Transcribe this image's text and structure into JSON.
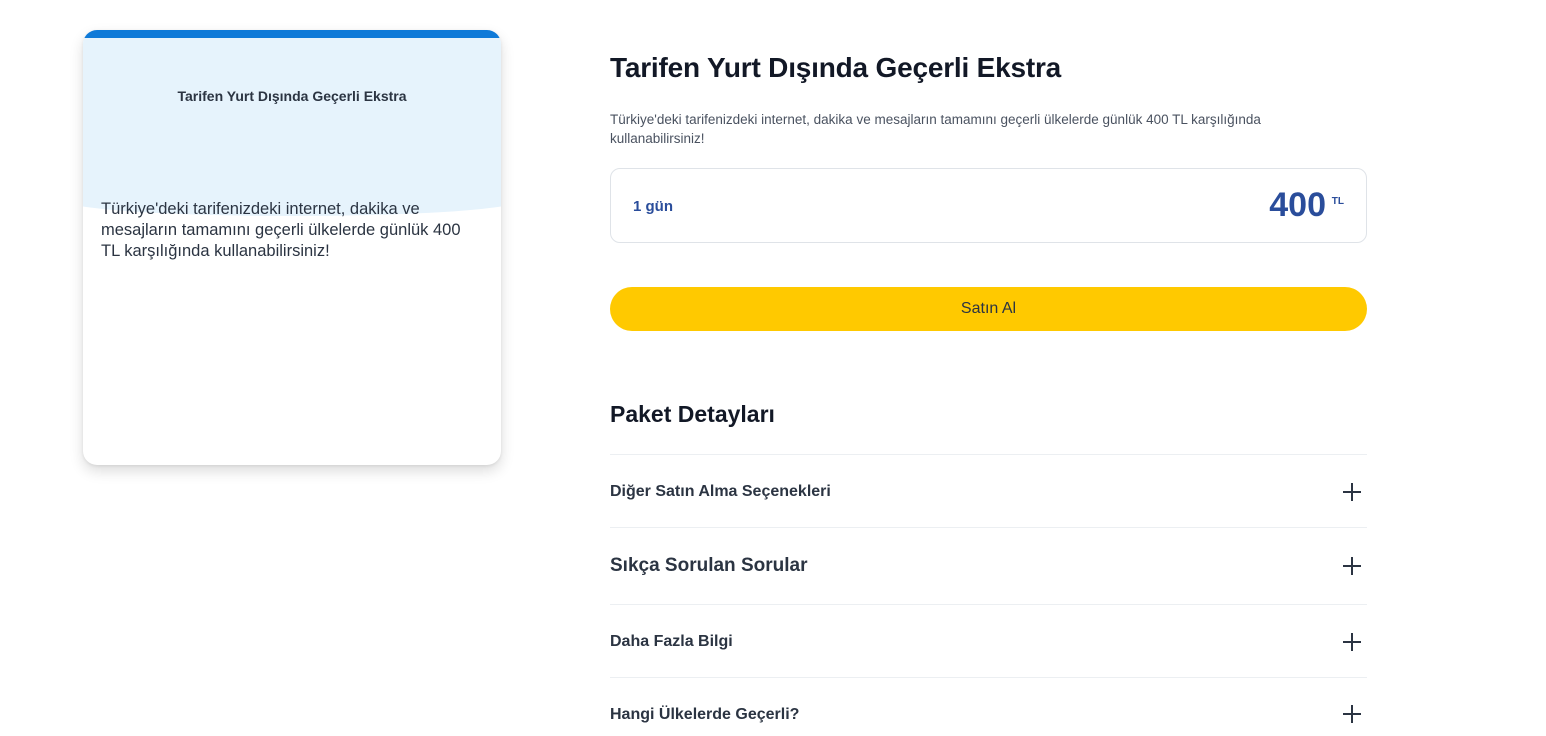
{
  "card": {
    "header_title": "Tarifen Yurt Dışında Geçerli Ekstra",
    "description": "Türkiye'deki tarifenizdeki internet, dakika ve mesajların tamamını geçerli ülkelerde günlük 400 TL karşılığında kullanabilirsiniz!"
  },
  "main": {
    "title": "Tarifen Yurt Dışında Geçerli Ekstra",
    "description": "Türkiye'deki tarifenizdeki internet, dakika ve mesajların tamamını geçerli ülkelerde günlük 400 TL karşılığında kullanabilirsiniz!",
    "option": {
      "duration": "1 gün",
      "price": "400",
      "currency": "TL"
    },
    "buy_label": "Satın Al"
  },
  "details": {
    "title": "Paket Detayları",
    "items": [
      {
        "label": "Diğer Satın Alma Seçenekleri"
      },
      {
        "label": "Sıkça Sorulan Sorular"
      },
      {
        "label": "Daha Fazla Bilgi"
      },
      {
        "label": "Hangi Ülkelerde Geçerli?"
      }
    ]
  },
  "colors": {
    "accent_blue": "#0f7ad8",
    "price_blue": "#2a4d9b",
    "buy_yellow": "#ffc900",
    "card_header_bg": "#e6f3fc"
  }
}
